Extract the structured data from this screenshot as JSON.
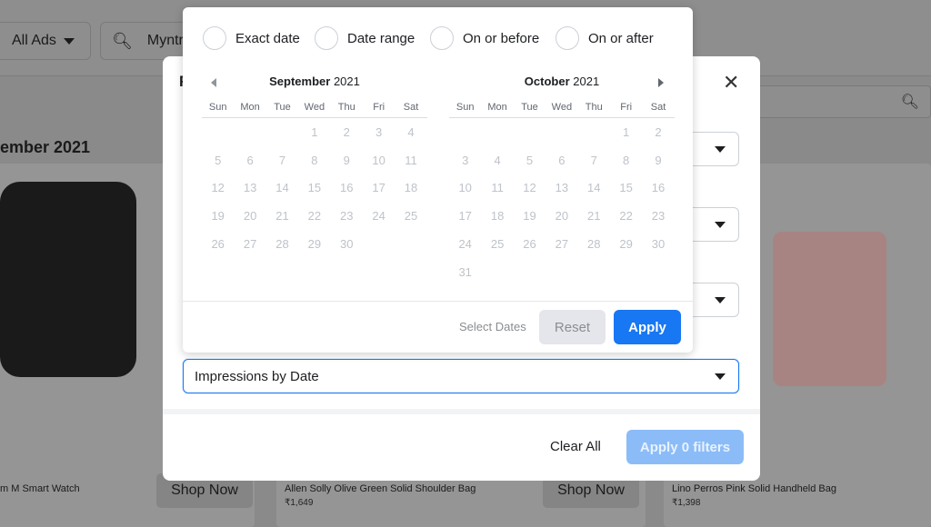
{
  "background": {
    "ads_filter": "All Ads",
    "search_value": "Myntra",
    "section_title": "ember 2021",
    "products": [
      {
        "title": "m M Smart Watch",
        "price": "",
        "shop": "Shop Now"
      },
      {
        "title": "Allen Solly Olive Green Solid Shoulder Bag",
        "price": "₹1,649",
        "shop": "Shop Now"
      },
      {
        "title": "Lino Perros Pink Solid Handheld Bag",
        "price": "₹1,398",
        "shop": ""
      }
    ]
  },
  "modal": {
    "title": "F",
    "close": "✕",
    "dropdown_active": "Impressions by Date",
    "clear_all": "Clear All",
    "apply_filters": "Apply 0 filters"
  },
  "datepicker": {
    "modes": [
      "Exact date",
      "Date range",
      "On or before",
      "On or after"
    ],
    "weekdays": [
      "Sun",
      "Mon",
      "Tue",
      "Wed",
      "Thu",
      "Fri",
      "Sat"
    ],
    "months": [
      {
        "month": "September",
        "year": "2021",
        "weeks": [
          [
            null,
            null,
            null,
            1,
            2,
            3,
            4
          ],
          [
            5,
            6,
            7,
            8,
            9,
            10,
            11
          ],
          [
            12,
            13,
            14,
            15,
            16,
            17,
            18
          ],
          [
            19,
            20,
            21,
            22,
            23,
            24,
            25
          ],
          [
            26,
            27,
            28,
            29,
            30,
            null,
            null
          ]
        ]
      },
      {
        "month": "October",
        "year": "2021",
        "weeks": [
          [
            null,
            null,
            null,
            null,
            null,
            1,
            2
          ],
          [
            3,
            4,
            5,
            6,
            7,
            8,
            9
          ],
          [
            10,
            11,
            12,
            13,
            14,
            15,
            16
          ],
          [
            17,
            18,
            19,
            20,
            21,
            22,
            23
          ],
          [
            24,
            25,
            26,
            27,
            28,
            29,
            30
          ],
          [
            31,
            null,
            null,
            null,
            null,
            null,
            null
          ]
        ]
      }
    ],
    "select_dates": "Select Dates",
    "reset": "Reset",
    "apply": "Apply"
  },
  "colors": {
    "primary": "#1877f2",
    "primary_disabled": "#8bbcf8"
  }
}
